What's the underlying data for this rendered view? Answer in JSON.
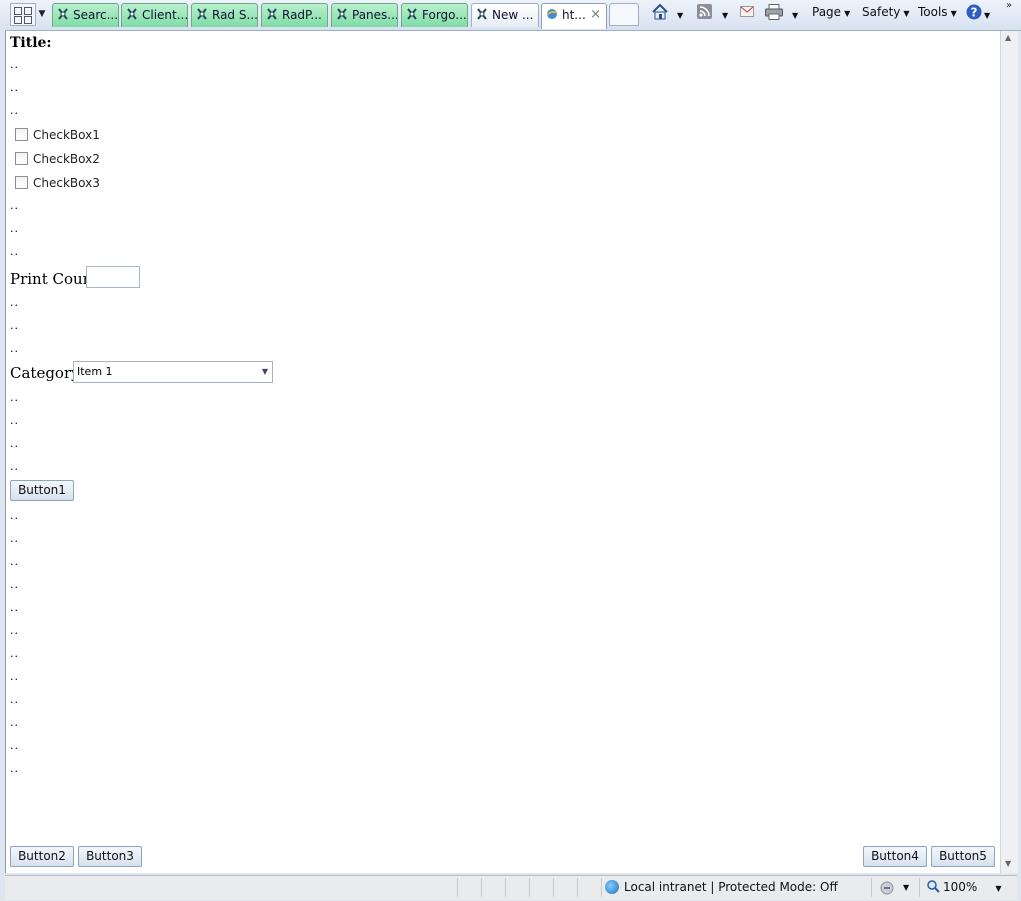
{
  "tabs": [
    {
      "label": "Searc..."
    },
    {
      "label": "Client..."
    },
    {
      "label": "Rad S..."
    },
    {
      "label": "RadP..."
    },
    {
      "label": "Panes..."
    },
    {
      "label": "Forgo..."
    },
    {
      "label": "New ..."
    },
    {
      "label": "ht..."
    }
  ],
  "toolbar": {
    "page_label": "Page",
    "safety_label": "Safety",
    "tools_label": "Tools",
    "tab_close_glyph": "×",
    "dropdown_glyph": "▼",
    "chevron_glyph": "»"
  },
  "content": {
    "title": "Title:",
    "filler": "..",
    "checkboxes": [
      {
        "label": "CheckBox1",
        "checked": false
      },
      {
        "label": "CheckBox2",
        "checked": false
      },
      {
        "label": "CheckBox3",
        "checked": false
      }
    ],
    "print_count_label": "Print Count:",
    "print_count_value": "",
    "category_label": "Category:",
    "category_value": "Item 1",
    "button1": "Button1",
    "button2": "Button2",
    "button3": "Button3",
    "button4": "Button4",
    "button5": "Button5"
  },
  "status": {
    "zone": "Local intranet | Protected Mode: Off",
    "zoom": "100%"
  },
  "colors": {
    "tab_green": "#7fdca6",
    "button_border": "#8ea3be"
  }
}
